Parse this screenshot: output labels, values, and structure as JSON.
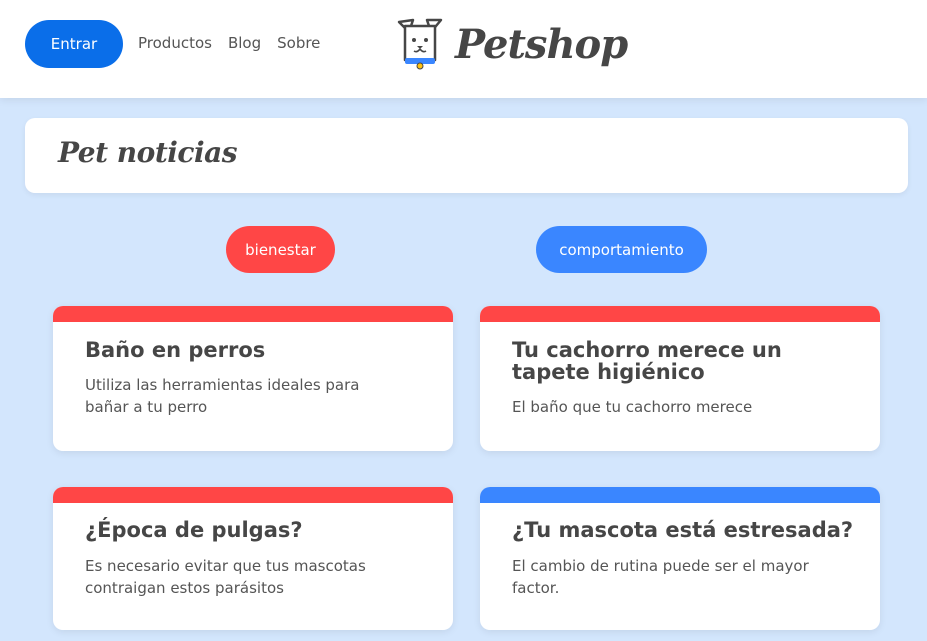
{
  "header": {
    "login_label": "Entrar",
    "nav": [
      "Productos",
      "Blog",
      "Sobre"
    ],
    "logo_text": "Petshop"
  },
  "main": {
    "section_title": "Pet noticias",
    "tags": [
      {
        "label": "bienestar",
        "color": "#ff4646"
      },
      {
        "label": "comportamiento",
        "color": "#3a86ff"
      }
    ],
    "cards": [
      {
        "title": "Baño en perros",
        "description": "Utiliza las herramientas ideales para bañar a tu perro",
        "category_color": "#ff4646"
      },
      {
        "title": "Tu cachorro merece un tapete higiénico",
        "description": "El baño que tu cachorro merece",
        "category_color": "#ff4646"
      },
      {
        "title": "¿Época de pulgas?",
        "description": "Es necesario evitar que tus mascotas contraigan estos parásitos",
        "category_color": "#ff4646"
      },
      {
        "title": "¿Tu mascota está estresada?",
        "description": "El cambio de rutina puede ser el mayor factor.",
        "category_color": "#3a86ff"
      }
    ]
  },
  "colors": {
    "background": "#d3e6fd",
    "primary": "#0a6ee9",
    "text": "#464646"
  }
}
